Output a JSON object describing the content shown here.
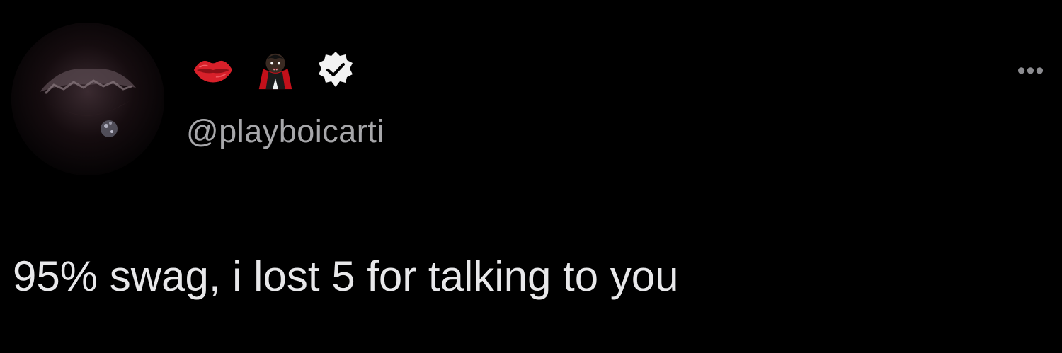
{
  "tweet": {
    "author": {
      "handle": "@playboicarti",
      "name_icons": [
        "lips-emoji",
        "vampire-emoji"
      ],
      "verified": true
    },
    "text": "95% swag, i lost 5 for talking to you",
    "more_label": "•••"
  },
  "colors": {
    "background": "#000000",
    "text": "#e8e8ea",
    "handle": "#a7a7aa",
    "lips": "#d8202a",
    "verified_badge": "#f2f2f2"
  }
}
